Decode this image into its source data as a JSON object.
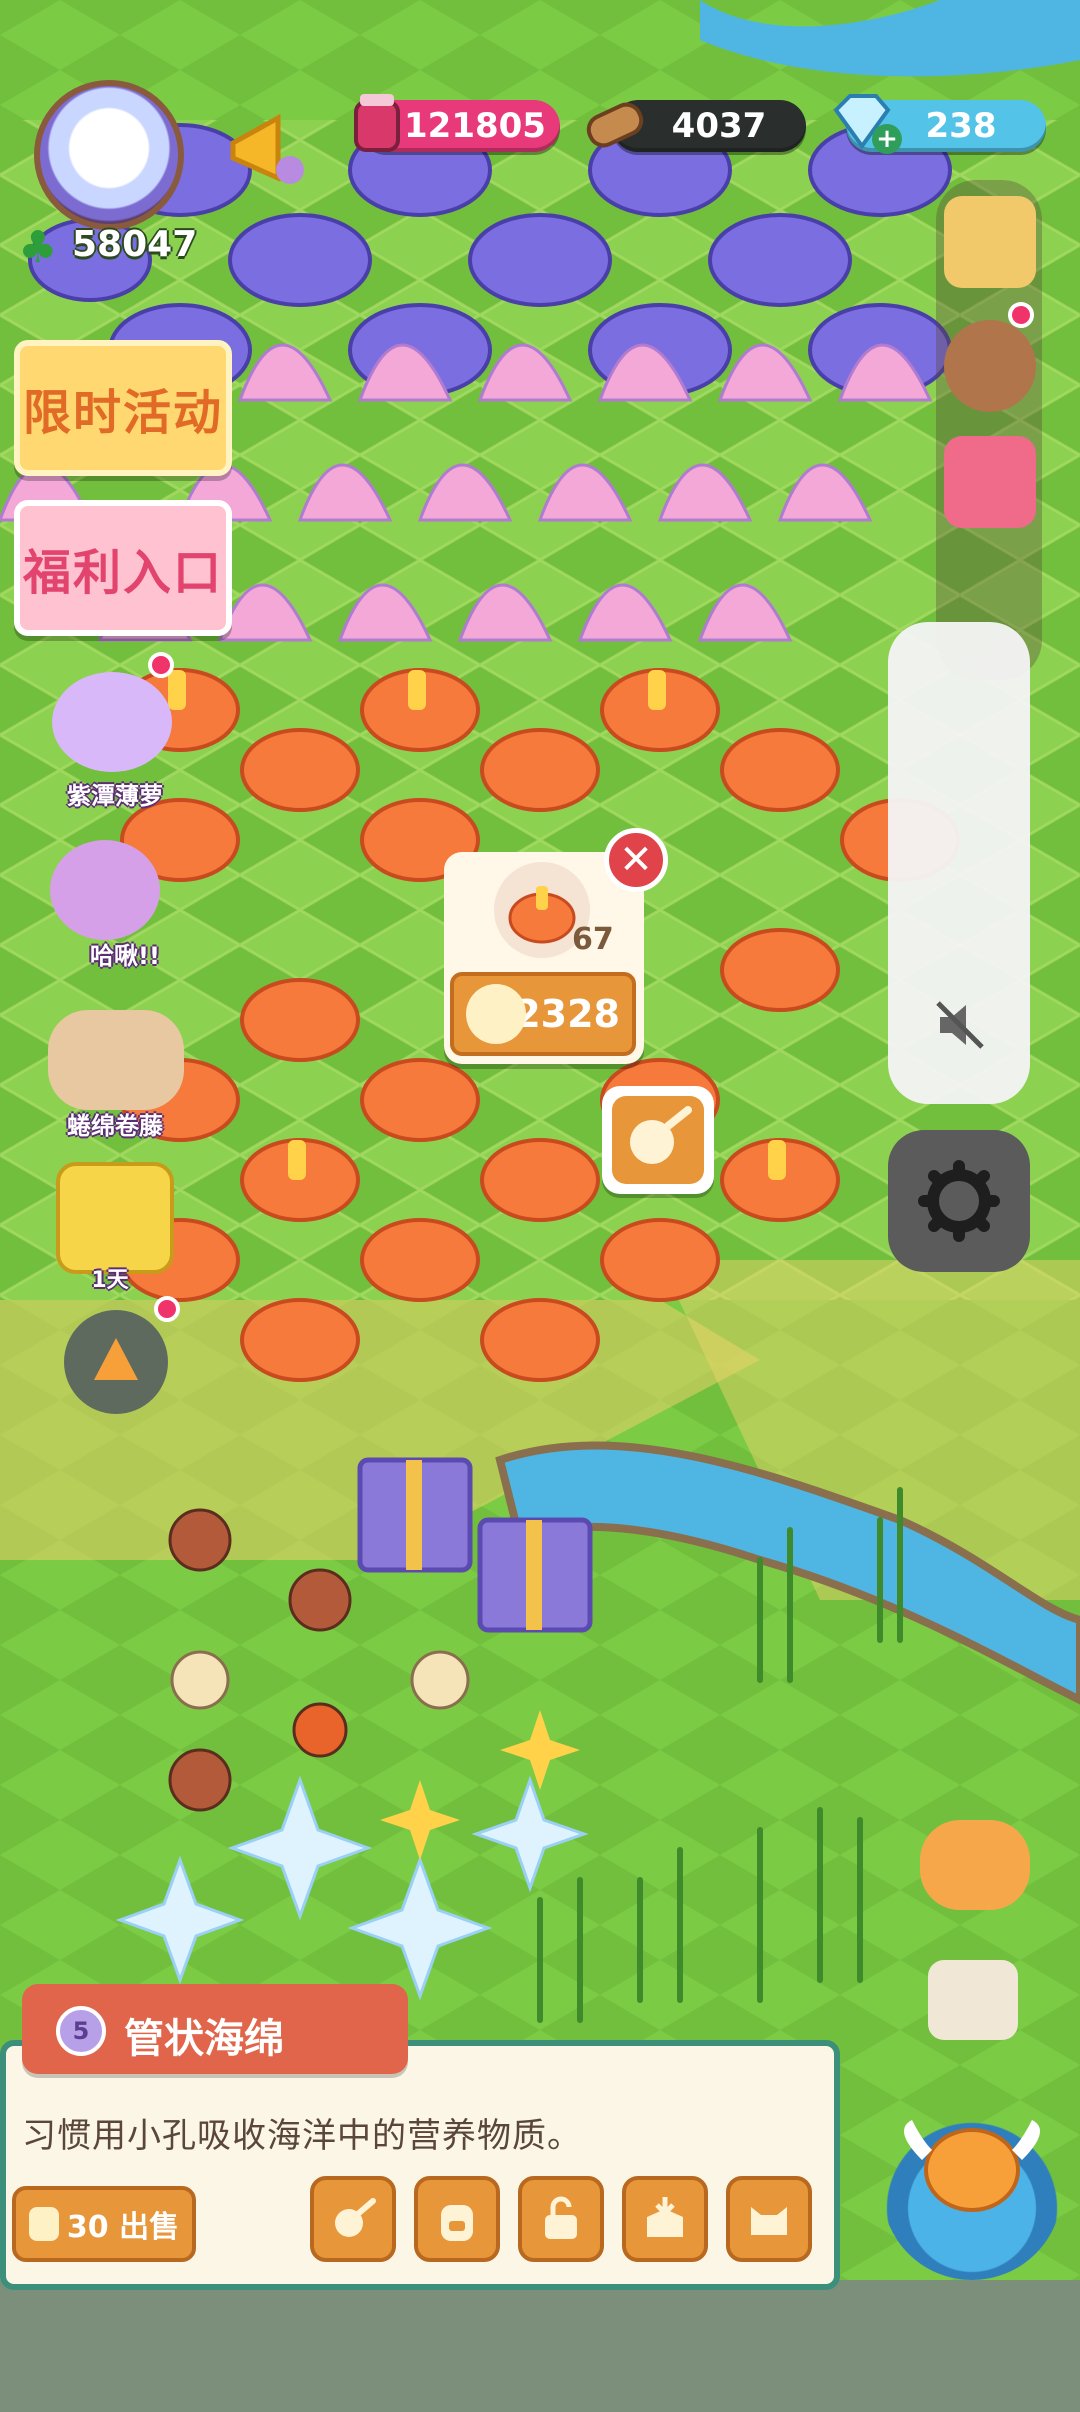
{
  "hud": {
    "clover_count": "58047",
    "resources": [
      {
        "name": "gem-jar",
        "value": "121805",
        "color": "#e83a7a"
      },
      {
        "name": "wood-log",
        "value": "4037",
        "color": "#2a2f2d"
      },
      {
        "name": "diamond",
        "value": "238",
        "color": "#53c3e8"
      }
    ]
  },
  "left_menu": {
    "limited_event": "限时活动",
    "welfare": "福利入口"
  },
  "side_characters": [
    {
      "label": "紫潭薄萝"
    },
    {
      "label": "哈啾!!"
    },
    {
      "label": "蜷绵卷藤"
    }
  ],
  "timer_badge": "1天",
  "popup": {
    "quantity": "67",
    "price": "2328",
    "close_symbol": "✕"
  },
  "item_panel": {
    "level": "5",
    "name": "管状海绵",
    "description": "习惯用小孔吸收海洋中的营养物质。",
    "sell_label": "30 出售",
    "actions": [
      "clean",
      "backpack",
      "unlock",
      "store",
      "cat"
    ]
  },
  "colors": {
    "grass": "#6fbf3a",
    "panel_border": "#3c8f7b",
    "button_orange": "#e7963a",
    "tag_red": "#e0654a"
  }
}
